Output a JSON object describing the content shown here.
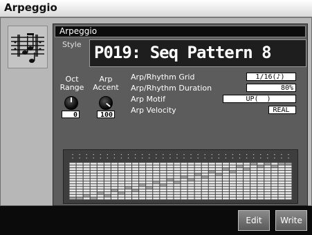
{
  "window": {
    "title": "Arpeggio"
  },
  "icon": "music-notes-icon",
  "panel": {
    "header": "Arpeggio",
    "style_label": "Style",
    "pattern": "P019: Seq Pattern 8"
  },
  "knobs": [
    {
      "label_line1": "Oct",
      "label_line2": "Range",
      "value": "0"
    },
    {
      "label_line1": "Arp",
      "label_line2": "Accent",
      "value": "100"
    }
  ],
  "params": [
    {
      "label": "Arp/Rhythm Grid",
      "value": "1/16(♪)"
    },
    {
      "label": "Arp/Rhythm Duration",
      "value": "80%"
    },
    {
      "label": "Arp Motif",
      "value": "UP(_ )"
    },
    {
      "label": "Arp Velocity",
      "value": "REAL"
    }
  ],
  "step_grid": {
    "columns": 32,
    "rows": 14,
    "active_rows": [
      0,
      0,
      1,
      0,
      2,
      1,
      3,
      2,
      4,
      3,
      5,
      4,
      6,
      5,
      7,
      6,
      8,
      7,
      9,
      8,
      10,
      9,
      11,
      10,
      12,
      11,
      13,
      12,
      13,
      12,
      13,
      13
    ]
  },
  "buttons": {
    "edit": "Edit",
    "write": "Write"
  },
  "colors": {
    "cell": "#e8e8e8",
    "active_cell": "#a8a8a8",
    "grid_bg": "#3e3e3e"
  }
}
